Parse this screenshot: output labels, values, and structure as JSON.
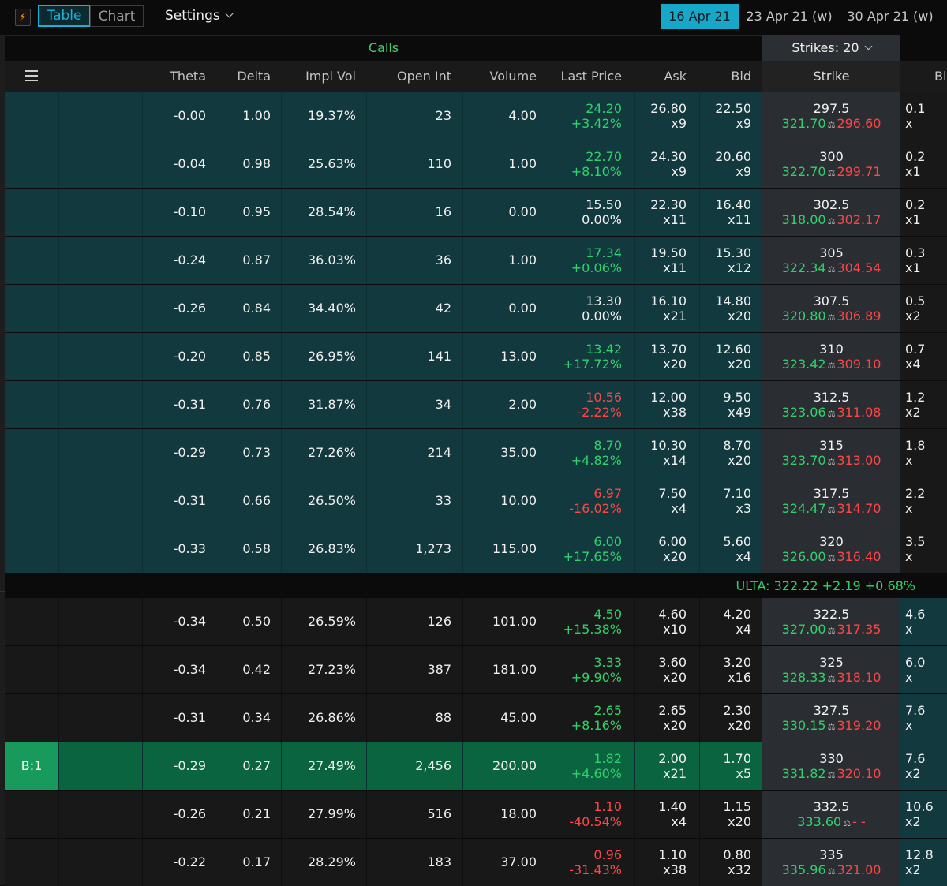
{
  "toolbar": {
    "logo_icon": "lightning-icon",
    "view_tabs": [
      "Table",
      "Chart"
    ],
    "settings_label": "Settings",
    "expirations": [
      "16 Apr 21",
      "23 Apr 21 (w)",
      "30 Apr 21 (w)"
    ]
  },
  "section": {
    "calls_label": "Calls",
    "strikes_label": "Strikes: 20"
  },
  "columns": [
    "Theta",
    "Delta",
    "Impl Vol",
    "Open Int",
    "Volume",
    "Last Price",
    "Ask",
    "Bid",
    "Strike",
    "Bi"
  ],
  "quote": "ULTA:  322.22 +2.19 +0.68%",
  "selected_badge": "B:1",
  "rows": [
    {
      "theta": "-0.00",
      "delta": "1.00",
      "iv": "19.37%",
      "oi": "23",
      "vol": "4.00",
      "last": "24.20",
      "chg": "+3.42%",
      "ask": "26.80",
      "ask_sz": "x9",
      "bid": "22.50",
      "bid_sz": "x9",
      "strike": "297.5",
      "s_hi": "321.70",
      "s_lo": "296.60",
      "put_bid": "0.1",
      "put_sz": "x",
      "dir": "up",
      "itm": true
    },
    {
      "theta": "-0.04",
      "delta": "0.98",
      "iv": "25.63%",
      "oi": "110",
      "vol": "1.00",
      "last": "22.70",
      "chg": "+8.10%",
      "ask": "24.30",
      "ask_sz": "x9",
      "bid": "20.60",
      "bid_sz": "x9",
      "strike": "300",
      "s_hi": "322.70",
      "s_lo": "299.71",
      "put_bid": "0.2",
      "put_sz": "x1",
      "dir": "up",
      "itm": true
    },
    {
      "theta": "-0.10",
      "delta": "0.95",
      "iv": "28.54%",
      "oi": "16",
      "vol": "0.00",
      "last": "15.50",
      "chg": "0.00%",
      "ask": "22.30",
      "ask_sz": "x11",
      "bid": "16.40",
      "bid_sz": "x11",
      "strike": "302.5",
      "s_hi": "318.00",
      "s_lo": "302.17",
      "put_bid": "0.2",
      "put_sz": "x1",
      "dir": "flat",
      "itm": true
    },
    {
      "theta": "-0.24",
      "delta": "0.87",
      "iv": "36.03%",
      "oi": "36",
      "vol": "1.00",
      "last": "17.34",
      "chg": "+0.06%",
      "ask": "19.50",
      "ask_sz": "x11",
      "bid": "15.30",
      "bid_sz": "x12",
      "strike": "305",
      "s_hi": "322.34",
      "s_lo": "304.54",
      "put_bid": "0.3",
      "put_sz": "x1",
      "dir": "up",
      "itm": true
    },
    {
      "theta": "-0.26",
      "delta": "0.84",
      "iv": "34.40%",
      "oi": "42",
      "vol": "0.00",
      "last": "13.30",
      "chg": "0.00%",
      "ask": "16.10",
      "ask_sz": "x21",
      "bid": "14.80",
      "bid_sz": "x20",
      "strike": "307.5",
      "s_hi": "320.80",
      "s_lo": "306.89",
      "put_bid": "0.5",
      "put_sz": "x2",
      "dir": "flat",
      "itm": true
    },
    {
      "theta": "-0.20",
      "delta": "0.85",
      "iv": "26.95%",
      "oi": "141",
      "vol": "13.00",
      "last": "13.42",
      "chg": "+17.72%",
      "ask": "13.70",
      "ask_sz": "x20",
      "bid": "12.60",
      "bid_sz": "x20",
      "strike": "310",
      "s_hi": "323.42",
      "s_lo": "309.10",
      "put_bid": "0.7",
      "put_sz": "x4",
      "dir": "up",
      "itm": true
    },
    {
      "theta": "-0.31",
      "delta": "0.76",
      "iv": "31.87%",
      "oi": "34",
      "vol": "2.00",
      "last": "10.56",
      "chg": "-2.22%",
      "ask": "12.00",
      "ask_sz": "x38",
      "bid": "9.50",
      "bid_sz": "x49",
      "strike": "312.5",
      "s_hi": "323.06",
      "s_lo": "311.08",
      "put_bid": "1.2",
      "put_sz": "x2",
      "dir": "down",
      "itm": true
    },
    {
      "theta": "-0.29",
      "delta": "0.73",
      "iv": "27.26%",
      "oi": "214",
      "vol": "35.00",
      "last": "8.70",
      "chg": "+4.82%",
      "ask": "10.30",
      "ask_sz": "x14",
      "bid": "8.70",
      "bid_sz": "x20",
      "strike": "315",
      "s_hi": "323.70",
      "s_lo": "313.00",
      "put_bid": "1.8",
      "put_sz": "x",
      "dir": "up",
      "itm": true
    },
    {
      "theta": "-0.31",
      "delta": "0.66",
      "iv": "26.50%",
      "oi": "33",
      "vol": "10.00",
      "last": "6.97",
      "chg": "-16.02%",
      "ask": "7.50",
      "ask_sz": "x4",
      "bid": "7.10",
      "bid_sz": "x3",
      "strike": "317.5",
      "s_hi": "324.47",
      "s_lo": "314.70",
      "put_bid": "2.2",
      "put_sz": "x",
      "dir": "down",
      "itm": true
    },
    {
      "theta": "-0.33",
      "delta": "0.58",
      "iv": "26.83%",
      "oi": "1,273",
      "vol": "115.00",
      "last": "6.00",
      "chg": "+17.65%",
      "ask": "6.00",
      "ask_sz": "x20",
      "bid": "5.60",
      "bid_sz": "x4",
      "strike": "320",
      "s_hi": "326.00",
      "s_lo": "316.40",
      "put_bid": "3.5",
      "put_sz": "x",
      "dir": "up",
      "itm": true
    },
    {
      "theta": "-0.34",
      "delta": "0.50",
      "iv": "26.59%",
      "oi": "126",
      "vol": "101.00",
      "last": "4.50",
      "chg": "+15.38%",
      "ask": "4.60",
      "ask_sz": "x10",
      "bid": "4.20",
      "bid_sz": "x4",
      "strike": "322.5",
      "s_hi": "327.00",
      "s_lo": "317.35",
      "put_bid": "4.6",
      "put_sz": "x",
      "dir": "up",
      "itm": false
    },
    {
      "theta": "-0.34",
      "delta": "0.42",
      "iv": "27.23%",
      "oi": "387",
      "vol": "181.00",
      "last": "3.33",
      "chg": "+9.90%",
      "ask": "3.60",
      "ask_sz": "x20",
      "bid": "3.20",
      "bid_sz": "x16",
      "strike": "325",
      "s_hi": "328.33",
      "s_lo": "318.10",
      "put_bid": "6.0",
      "put_sz": "x",
      "dir": "up",
      "itm": false
    },
    {
      "theta": "-0.31",
      "delta": "0.34",
      "iv": "26.86%",
      "oi": "88",
      "vol": "45.00",
      "last": "2.65",
      "chg": "+8.16%",
      "ask": "2.65",
      "ask_sz": "x20",
      "bid": "2.30",
      "bid_sz": "x20",
      "strike": "327.5",
      "s_hi": "330.15",
      "s_lo": "319.20",
      "put_bid": "7.6",
      "put_sz": "x",
      "dir": "up",
      "itm": false
    },
    {
      "theta": "-0.29",
      "delta": "0.27",
      "iv": "27.49%",
      "oi": "2,456",
      "vol": "200.00",
      "last": "1.82",
      "chg": "+4.60%",
      "ask": "2.00",
      "ask_sz": "x21",
      "bid": "1.70",
      "bid_sz": "x5",
      "strike": "330",
      "s_hi": "331.82",
      "s_lo": "320.10",
      "put_bid": "7.6",
      "put_sz": "x2",
      "dir": "up",
      "itm": false,
      "selected": true
    },
    {
      "theta": "-0.26",
      "delta": "0.21",
      "iv": "27.99%",
      "oi": "516",
      "vol": "18.00",
      "last": "1.10",
      "chg": "-40.54%",
      "ask": "1.40",
      "ask_sz": "x4",
      "bid": "1.15",
      "bid_sz": "x20",
      "strike": "332.5",
      "s_hi": "333.60",
      "s_lo": "- -",
      "put_bid": "10.6",
      "put_sz": "x2",
      "dir": "down",
      "itm": false
    },
    {
      "theta": "-0.22",
      "delta": "0.17",
      "iv": "28.29%",
      "oi": "183",
      "vol": "37.00",
      "last": "0.96",
      "chg": "-31.43%",
      "ask": "1.10",
      "ask_sz": "x38",
      "bid": "0.80",
      "bid_sz": "x32",
      "strike": "335",
      "s_hi": "335.96",
      "s_lo": "321.00",
      "put_bid": "12.8",
      "put_sz": "x2",
      "dir": "down",
      "itm": false
    }
  ],
  "colors": {
    "accent": "#17a8c9",
    "itm_bg": "#11393e",
    "selected_bg": "#0b6440",
    "up": "#2fd26a",
    "down": "#ff4545"
  }
}
